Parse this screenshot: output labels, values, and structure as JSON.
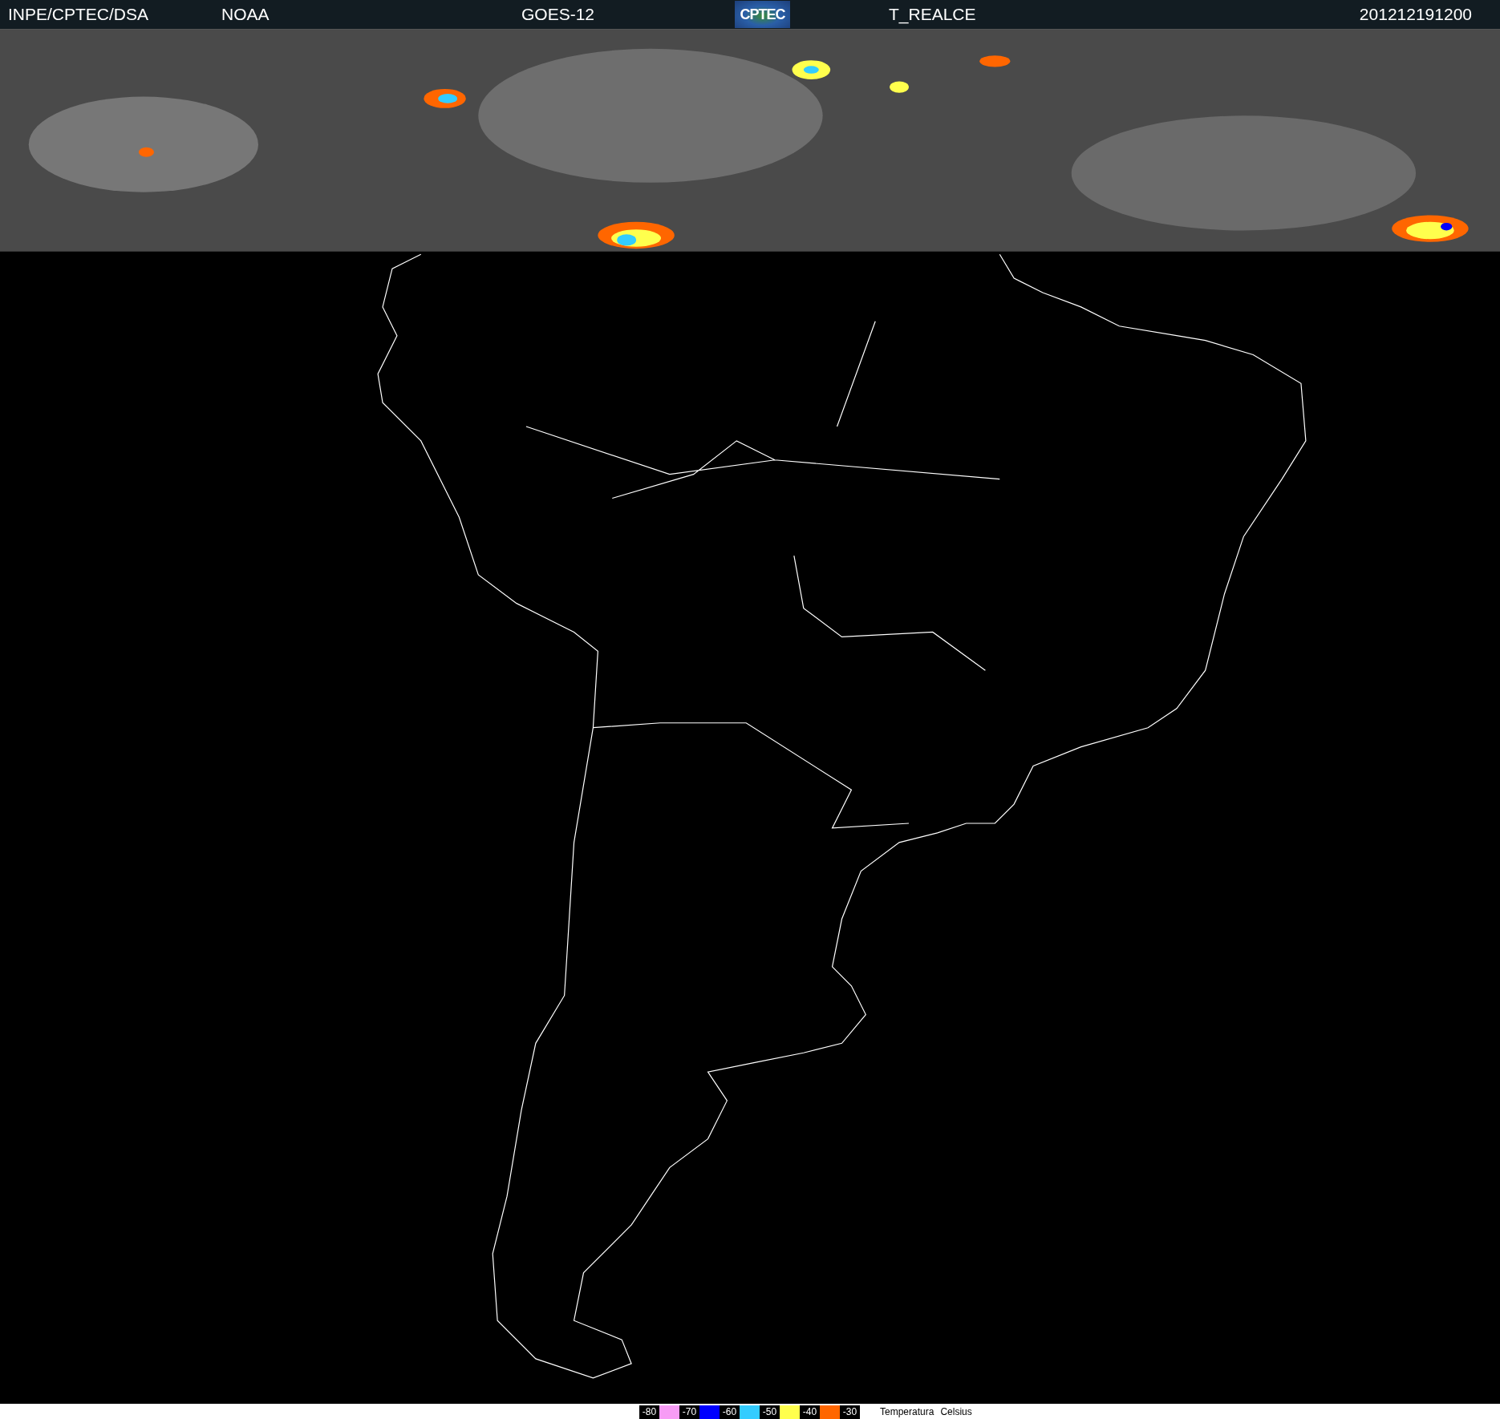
{
  "header": {
    "source": "INPE/CPTEC/DSA",
    "agency": "NOAA",
    "satellite": "GOES-12",
    "logo": "CPTEC",
    "product": "T_REALCE",
    "timestamp": "201212191200"
  },
  "legend": {
    "items": [
      {
        "label": "-80",
        "color": "#f79cf5"
      },
      {
        "label": "-70",
        "color": "#0000ff"
      },
      {
        "label": "-60",
        "color": "#33ccff"
      },
      {
        "label": "-50",
        "color": "#ffff4d"
      },
      {
        "label": "-40",
        "color": "#ff6600"
      },
      {
        "label": "-30"
      }
    ],
    "title": "Temperatura",
    "unit": "Celsius"
  }
}
